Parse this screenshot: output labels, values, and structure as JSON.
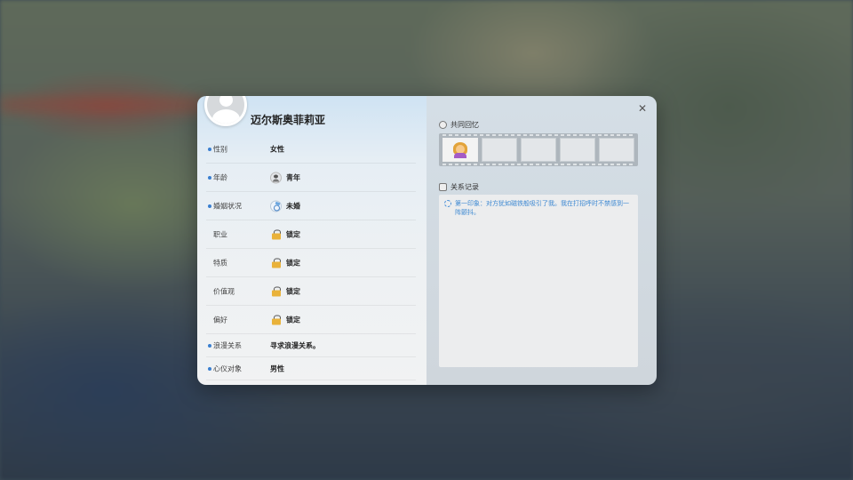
{
  "character": {
    "name": "迈尔斯奥菲莉亚"
  },
  "profile_rows": [
    {
      "label": "性别",
      "value": "女性",
      "dot": true,
      "icon": "",
      "locked": false
    },
    {
      "label": "年龄",
      "value": "青年",
      "dot": true,
      "icon": "person-icon",
      "locked": false
    },
    {
      "label": "婚姻状况",
      "value": "未婚",
      "dot": true,
      "icon": "ring-icon",
      "locked": false
    },
    {
      "label": "职业",
      "value": "锁定",
      "dot": false,
      "icon": "lock-icon",
      "locked": true
    },
    {
      "label": "特质",
      "value": "锁定",
      "dot": false,
      "icon": "lock-icon",
      "locked": true
    },
    {
      "label": "价值观",
      "value": "锁定",
      "dot": false,
      "icon": "lock-icon",
      "locked": true
    },
    {
      "label": "偏好",
      "value": "锁定",
      "dot": false,
      "icon": "lock-icon",
      "locked": true
    },
    {
      "label": "浪漫关系",
      "value": "寻求浪漫关系。",
      "dot": true,
      "icon": "",
      "locked": false
    },
    {
      "label": "心仪对象",
      "value": "男性",
      "dot": true,
      "icon": "",
      "locked": false
    }
  ],
  "memories": {
    "title": "共同回忆",
    "slots": [
      {
        "filled": true,
        "icon": "memory-portrait-icon"
      },
      {
        "filled": false
      },
      {
        "filled": false
      },
      {
        "filled": false
      },
      {
        "filled": false
      }
    ]
  },
  "records": {
    "title": "关系记录",
    "items": [
      {
        "text": "第一印象：对方犹如磁铁般吸引了我。我在打招呼时不禁感到一阵颤抖。"
      }
    ]
  },
  "close": {
    "label": "✕"
  },
  "colors": {
    "accent": "#3a7fd0",
    "record_text": "#3c88d2",
    "lock": "#e9b23a"
  }
}
